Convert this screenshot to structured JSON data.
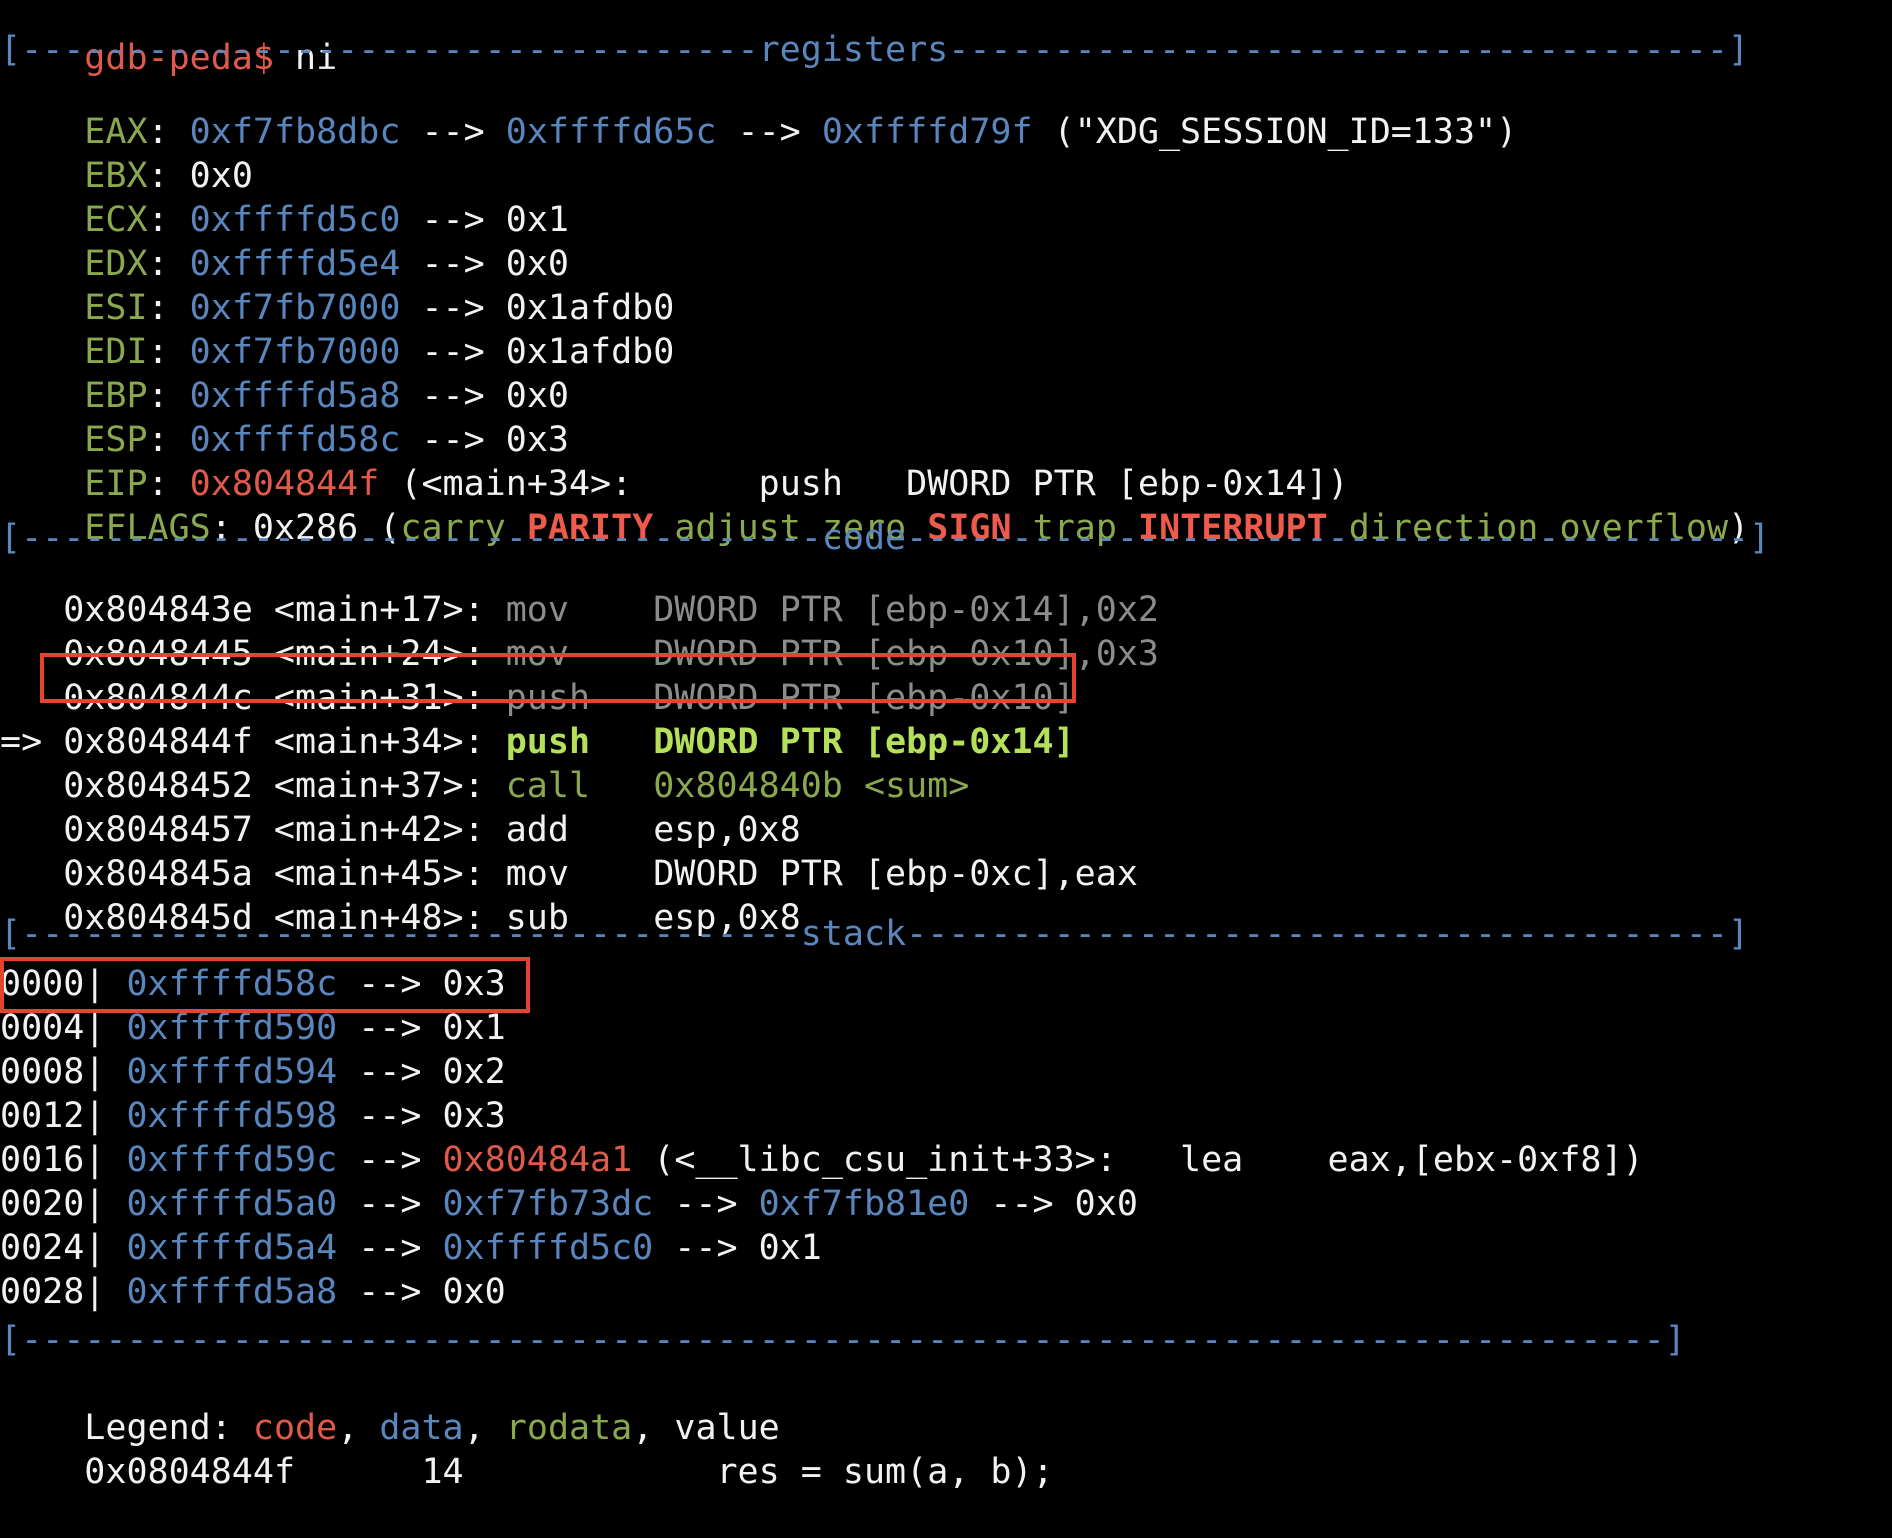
{
  "prompt": {
    "text": "gdb-peda$",
    "command": " ni"
  },
  "sections": {
    "registers": "registers",
    "code": "code",
    "stack": "stack"
  },
  "registers": {
    "eax": {
      "name": "EAX",
      "chain": [
        {
          "text": "0xf7fb8dbc",
          "color": "c"
        },
        {
          "text": " --> ",
          "color": "w"
        },
        {
          "text": "0xffffd65c",
          "color": "c"
        },
        {
          "text": " --> ",
          "color": "w"
        },
        {
          "text": "0xffffd79f",
          "color": "c"
        },
        {
          "text": " (\"XDG_SESSION_ID=133\")",
          "color": "w"
        }
      ]
    },
    "ebx": {
      "name": "EBX",
      "chain": [
        {
          "text": "0x0",
          "color": "w"
        }
      ]
    },
    "ecx": {
      "name": "ECX",
      "chain": [
        {
          "text": "0xffffd5c0",
          "color": "c"
        },
        {
          "text": " --> 0x1",
          "color": "w"
        }
      ]
    },
    "edx": {
      "name": "EDX",
      "chain": [
        {
          "text": "0xffffd5e4",
          "color": "c"
        },
        {
          "text": " --> 0x0",
          "color": "w"
        }
      ]
    },
    "esi": {
      "name": "ESI",
      "chain": [
        {
          "text": "0xf7fb7000",
          "color": "c"
        },
        {
          "text": " --> 0x1afdb0",
          "color": "w"
        }
      ]
    },
    "edi": {
      "name": "EDI",
      "chain": [
        {
          "text": "0xf7fb7000",
          "color": "c"
        },
        {
          "text": " --> 0x1afdb0",
          "color": "w"
        }
      ]
    },
    "ebp": {
      "name": "EBP",
      "chain": [
        {
          "text": "0xffffd5a8",
          "color": "c"
        },
        {
          "text": " --> 0x0",
          "color": "w"
        }
      ]
    },
    "esp": {
      "name": "ESP",
      "chain": [
        {
          "text": "0xffffd58c",
          "color": "c"
        },
        {
          "text": " --> 0x3",
          "color": "w"
        }
      ]
    },
    "eip": {
      "name": "EIP",
      "chain": [
        {
          "text": "0x804844f",
          "color": "r"
        },
        {
          "text": " (<main+34>:      push   DWORD PTR [ebp-0x14])",
          "color": "w"
        }
      ]
    },
    "eflags": {
      "name": "EFLAGS",
      "chain": [
        {
          "text": "0x286 (",
          "color": "w"
        },
        {
          "text": "carry",
          "color": "g"
        },
        {
          "text": " ",
          "color": "w"
        },
        {
          "text": "PARITY",
          "color": "rb"
        },
        {
          "text": " ",
          "color": "w"
        },
        {
          "text": "adjust",
          "color": "g"
        },
        {
          "text": " ",
          "color": "w"
        },
        {
          "text": "zero",
          "color": "g"
        },
        {
          "text": " ",
          "color": "w"
        },
        {
          "text": "SIGN",
          "color": "rb"
        },
        {
          "text": " ",
          "color": "w"
        },
        {
          "text": "trap",
          "color": "g"
        },
        {
          "text": " ",
          "color": "w"
        },
        {
          "text": "INTERRUPT",
          "color": "rb"
        },
        {
          "text": " ",
          "color": "w"
        },
        {
          "text": "direction",
          "color": "g"
        },
        {
          "text": " ",
          "color": "w"
        },
        {
          "text": "overflow",
          "color": "g"
        },
        {
          "text": ")",
          "color": "w"
        }
      ]
    }
  },
  "code": [
    {
      "marker": "   ",
      "addr": "0x804843e <main+17>:",
      "mnem": " mov    ",
      "ops": "DWORD PTR [ebp-0x14],0x2",
      "style": "past"
    },
    {
      "marker": "   ",
      "addr": "0x8048445 <main+24>:",
      "mnem": " mov    ",
      "ops": "DWORD PTR [ebp-0x10],0x3",
      "style": "past"
    },
    {
      "marker": "   ",
      "addr": "0x804844c <main+31>:",
      "mnem": " push   ",
      "ops": "DWORD PTR [ebp-0x10]",
      "style": "past"
    },
    {
      "marker": "=> ",
      "addr": "0x804844f <main+34>:",
      "mnem": " push   ",
      "ops": "DWORD PTR [ebp-0x14]",
      "style": "current"
    },
    {
      "marker": "   ",
      "addr": "0x8048452 <main+37>:",
      "mnem": " call   ",
      "ops": "0x804840b <sum>",
      "style": "call"
    },
    {
      "marker": "   ",
      "addr": "0x8048457 <main+42>:",
      "mnem": " add    ",
      "ops": "esp,0x8",
      "style": "future"
    },
    {
      "marker": "   ",
      "addr": "0x804845a <main+45>:",
      "mnem": " mov    ",
      "ops": "DWORD PTR [ebp-0xc],eax",
      "style": "future"
    },
    {
      "marker": "   ",
      "addr": "0x804845d <main+48>:",
      "mnem": " sub    ",
      "ops": "esp,0x8",
      "style": "future"
    }
  ],
  "stack": [
    {
      "off": "0000|",
      "chain": [
        {
          "text": " ",
          "color": "w"
        },
        {
          "text": "0xffffd58c",
          "color": "c"
        },
        {
          "text": " --> 0x3",
          "color": "w"
        }
      ]
    },
    {
      "off": "0004|",
      "chain": [
        {
          "text": " ",
          "color": "w"
        },
        {
          "text": "0xffffd590",
          "color": "c"
        },
        {
          "text": " --> 0x1",
          "color": "w"
        }
      ]
    },
    {
      "off": "0008|",
      "chain": [
        {
          "text": " ",
          "color": "w"
        },
        {
          "text": "0xffffd594",
          "color": "c"
        },
        {
          "text": " --> 0x2",
          "color": "w"
        }
      ]
    },
    {
      "off": "0012|",
      "chain": [
        {
          "text": " ",
          "color": "w"
        },
        {
          "text": "0xffffd598",
          "color": "c"
        },
        {
          "text": " --> 0x3",
          "color": "w"
        }
      ]
    },
    {
      "off": "0016|",
      "chain": [
        {
          "text": " ",
          "color": "w"
        },
        {
          "text": "0xffffd59c",
          "color": "c"
        },
        {
          "text": " --> ",
          "color": "w"
        },
        {
          "text": "0x80484a1",
          "color": "r"
        },
        {
          "text": " (<__libc_csu_init+33>:   lea    eax,[ebx-0xf8])",
          "color": "w"
        }
      ]
    },
    {
      "off": "0020|",
      "chain": [
        {
          "text": " ",
          "color": "w"
        },
        {
          "text": "0xffffd5a0",
          "color": "c"
        },
        {
          "text": " --> ",
          "color": "w"
        },
        {
          "text": "0xf7fb73dc",
          "color": "c"
        },
        {
          "text": " --> ",
          "color": "w"
        },
        {
          "text": "0xf7fb81e0",
          "color": "c"
        },
        {
          "text": " --> 0x0",
          "color": "w"
        }
      ]
    },
    {
      "off": "0024|",
      "chain": [
        {
          "text": " ",
          "color": "w"
        },
        {
          "text": "0xffffd5a4",
          "color": "c"
        },
        {
          "text": " --> ",
          "color": "w"
        },
        {
          "text": "0xffffd5c0",
          "color": "c"
        },
        {
          "text": " --> 0x1",
          "color": "w"
        }
      ]
    },
    {
      "off": "0028|",
      "chain": [
        {
          "text": " ",
          "color": "w"
        },
        {
          "text": "0xffffd5a8",
          "color": "c"
        },
        {
          "text": " --> 0x0",
          "color": "w"
        }
      ]
    }
  ],
  "legend": {
    "label": "Legend:",
    "code": "code",
    "data": "data",
    "rodata": "rodata",
    "value": "value"
  },
  "source": {
    "addr": "0x0804844f",
    "lineno": "14",
    "text": "res = sum(a, b);"
  },
  "colors": {
    "background": "#000000",
    "text": "#f2f2f2",
    "register_name": "#8aa84e",
    "address": "#5a86bd",
    "code_pointer": "#e05a4c",
    "current_instruction": "#b5e05a",
    "highlight_box": "#e8432e"
  }
}
